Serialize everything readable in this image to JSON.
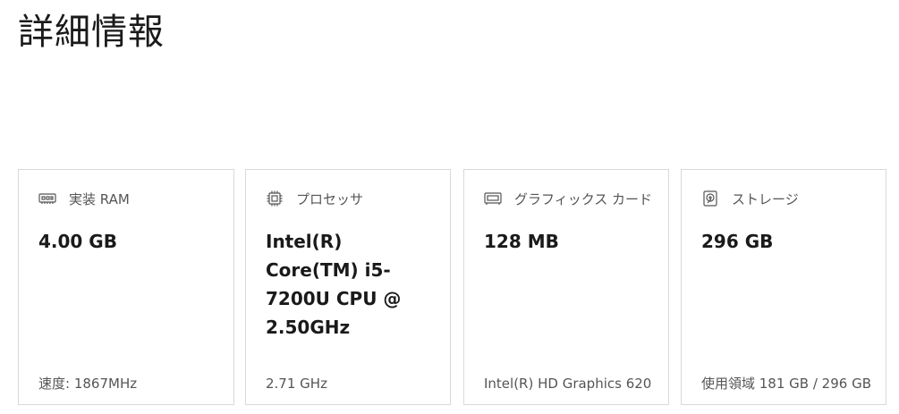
{
  "page": {
    "title": "詳細情報"
  },
  "cards": [
    {
      "id": "ram",
      "icon": "memory-icon",
      "label": "実装 RAM",
      "value": "4.00 GB",
      "footer": "速度: 1867MHz"
    },
    {
      "id": "processor",
      "icon": "processor-icon",
      "label": "プロセッサ",
      "value": "Intel(R) Core(TM) i5-7200U CPU @ 2.50GHz",
      "footer": "2.71 GHz"
    },
    {
      "id": "graphics",
      "icon": "graphics-card-icon",
      "label": "グラフィックス カード",
      "value": "128 MB",
      "footer": "Intel(R) HD Graphics 620"
    },
    {
      "id": "storage",
      "icon": "storage-icon",
      "label": "ストレージ",
      "value": "296 GB",
      "footer": "使用領域 181 GB / 296 GB"
    }
  ],
  "colors": {
    "border": "#d9d9d9",
    "text_primary": "#1a1a1a",
    "text_secondary": "#555555",
    "background": "#ffffff"
  }
}
